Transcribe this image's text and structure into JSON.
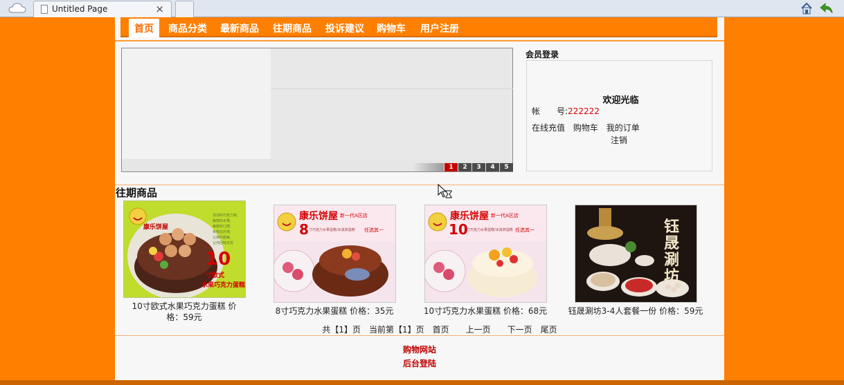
{
  "browser": {
    "tab_title": "Untitled Page",
    "tab_close": "×"
  },
  "nav": {
    "items": [
      "首页",
      "商品分类",
      "最新商品",
      "往期商品",
      "投诉建议",
      "购物车",
      "用户注册"
    ]
  },
  "banner": {
    "pager": [
      "1",
      "2",
      "3",
      "4",
      "5"
    ],
    "active_page": "1"
  },
  "login": {
    "title": "会员登录",
    "welcome": "欢迎光临",
    "account_label": "帐　　号:",
    "account_value": "222222",
    "links": [
      "在线充值",
      "购物车",
      "我的订单"
    ],
    "logout": "注销"
  },
  "section_title": "往期商品",
  "products": [
    {
      "caption": "10寸欧式水果巧克力蛋糕 价格：59元",
      "image_text": "10寸欧式 水果巧克力蛋糕",
      "brand": "康乐饼屋"
    },
    {
      "caption": "8寸巧克力水果蛋糕 价格：35元",
      "image_text": "8",
      "brand": "康乐饼屋",
      "slogan": "新一代A区店",
      "offer": "任选其一"
    },
    {
      "caption": "10寸巧克力水果蛋糕 价格：68元",
      "image_text": "10",
      "brand": "康乐饼屋",
      "slogan": "新一代A区店",
      "offer": "任选其一"
    },
    {
      "caption": "钰晟涮坊3-4人套餐一份 价格：59元",
      "image_text": "钰晟涮坊",
      "brand": "钰晟涮坊"
    }
  ],
  "pagination": "共【1】页　当前第【1】页　首页　　上一页　　下一页　尾页",
  "footer": {
    "link1": "购物网站",
    "link2": "后台登陆"
  }
}
